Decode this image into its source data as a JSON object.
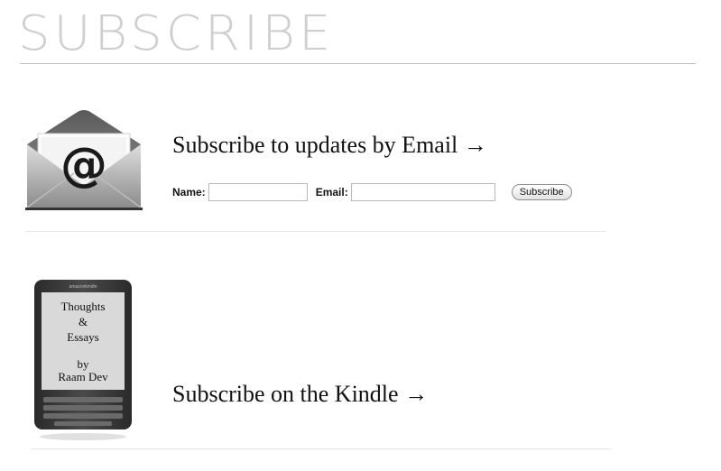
{
  "page": {
    "title": "SUBSCRIBE"
  },
  "email_section": {
    "heading": "Subscribe to updates by Email →",
    "name_label": "Name:",
    "name_value": "",
    "email_label": "Email:",
    "email_value": "",
    "subscribe_button": "Subscribe",
    "icon": "envelope-at-icon"
  },
  "kindle_section": {
    "heading": "Subscribe on the Kindle →",
    "icon": "kindle-device-icon",
    "screen_lines": [
      "Thoughts",
      "&",
      "Essays",
      "by",
      "Raam Dev"
    ],
    "brand": "amazonkindle"
  }
}
